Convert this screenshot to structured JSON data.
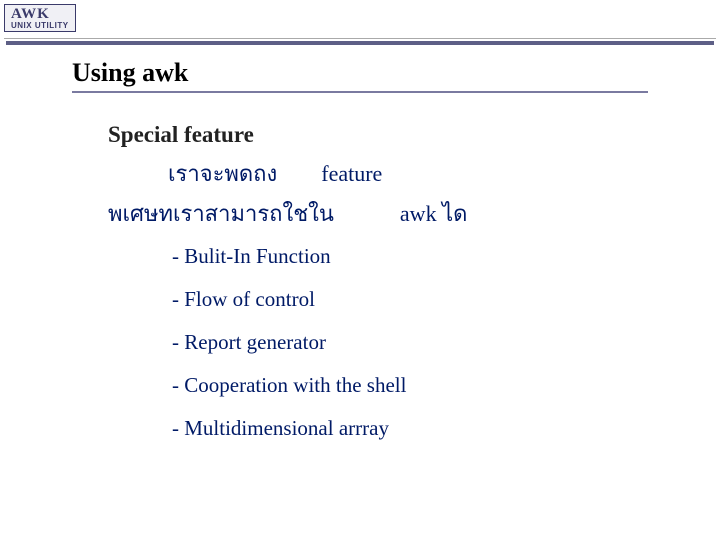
{
  "logo": {
    "main": "AWK",
    "sub": "UNIX UTILITY"
  },
  "title": "Using awk",
  "subheading": "Special feature",
  "intro": {
    "line1_a": "เราจะพดถง",
    "line1_b": "feature",
    "line2_a": "พเศษทเราสามารถใชใน",
    "line2_b": "awk ได"
  },
  "items": [
    "- Bulit-In Function",
    "- Flow of control",
    "- Report generator",
    "- Cooperation with the shell",
    "- Multidimensional arrray"
  ]
}
